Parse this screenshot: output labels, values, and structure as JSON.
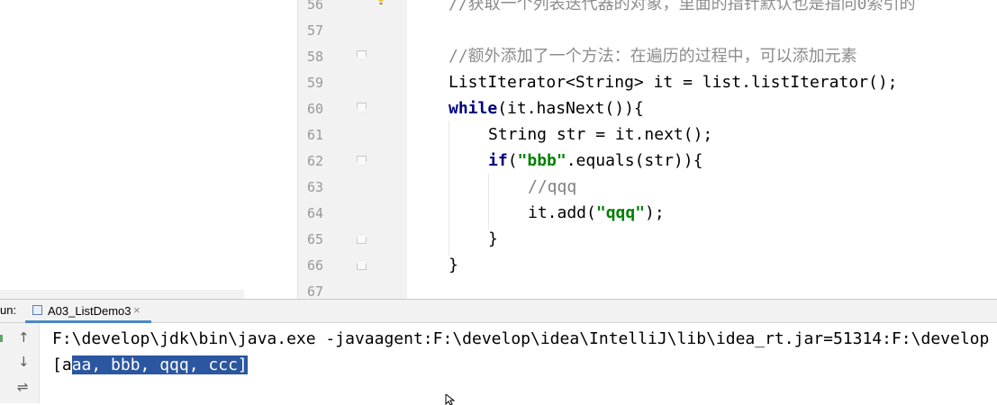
{
  "editor": {
    "line_numbers": [
      "56",
      "57",
      "58",
      "59",
      "60",
      "61",
      "62",
      "63",
      "64",
      "65",
      "66",
      "67"
    ],
    "lines": {
      "l56": "//获取一个列表迭代器的对象，里面的指针默认也是指向0索引的",
      "l58": "//额外添加了一个方法：在遍历的过程中，可以添加元素",
      "l59": "ListIterator<String> it = list.listIterator();",
      "l60_kw": "while",
      "l60_rest": "(it.hasNext()){",
      "l61": "String str = it.next();",
      "l62_kw": "if",
      "l62_open": "(",
      "l62_str": "\"bbb\"",
      "l62_rest": ".equals(str)){",
      "l63": "//qqq",
      "l64_a": "it.add(",
      "l64_str": "\"qqq\"",
      "l64_b": ");",
      "l65": "}",
      "l66": "}"
    }
  },
  "run_panel": {
    "run_label": "un:",
    "tab_label": "A03_ListDemo3",
    "tab_close": "×"
  },
  "console": {
    "command": "F:\\develop\\jdk\\bin\\java.exe -javaagent:F:\\develop\\idea\\IntelliJ\\lib\\idea_rt.jar=51314:F:\\develop",
    "output_prefix": "[a",
    "output_selected": "aa, bbb, qqq, ccc]"
  },
  "tools": {
    "up": "↑",
    "down": "↓",
    "wrap": "⇌"
  },
  "colors": {
    "keyword": "#000080",
    "string": "#008000",
    "selection": "#2b56a0",
    "tab_underline": "#4a88c7"
  }
}
